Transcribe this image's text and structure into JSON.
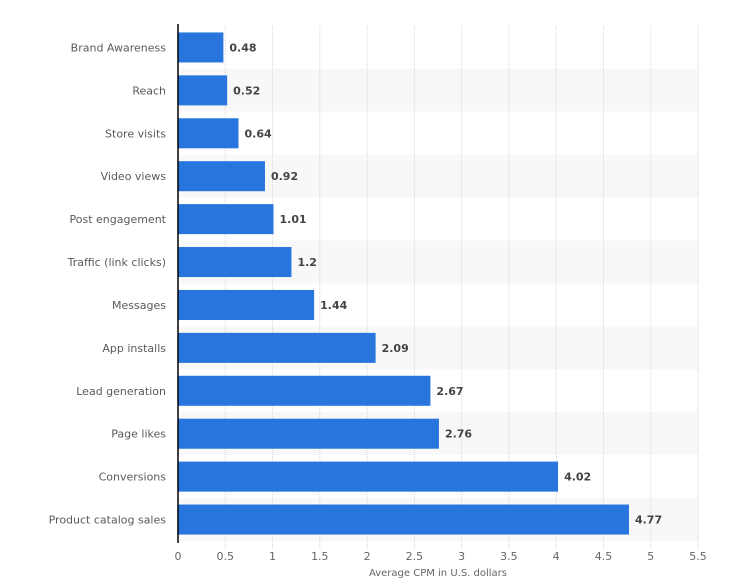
{
  "chart_data": {
    "type": "bar",
    "orientation": "horizontal",
    "title": "",
    "xlabel": "Average CPM in U.S. dollars",
    "ylabel": "",
    "xlim": [
      0,
      5.5
    ],
    "x_ticks": [
      0,
      0.5,
      1,
      1.5,
      2,
      2.5,
      3,
      3.5,
      4,
      4.5,
      5,
      5.5
    ],
    "x_tick_labels": [
      "0",
      "0.5",
      "1",
      "1.5",
      "2",
      "2.5",
      "3",
      "3.5",
      "4",
      "4.5",
      "5",
      "5.5"
    ],
    "grid": true,
    "legend": "none",
    "bar_color": "#2876dd",
    "categories": [
      "Brand Awareness",
      "Reach",
      "Store visits",
      "Video views",
      "Post engagement",
      "Traffic (link clicks)",
      "Messages",
      "App installs",
      "Lead generation",
      "Page likes",
      "Conversions",
      "Product catalog sales"
    ],
    "values": [
      0.48,
      0.52,
      0.64,
      0.92,
      1.01,
      1.2,
      1.44,
      2.09,
      2.67,
      2.76,
      4.02,
      4.77
    ],
    "value_labels": [
      "0.48",
      "0.52",
      "0.64",
      "0.92",
      "1.01",
      "1.2",
      "1.44",
      "2.09",
      "2.67",
      "2.76",
      "4.02",
      "4.77"
    ]
  }
}
